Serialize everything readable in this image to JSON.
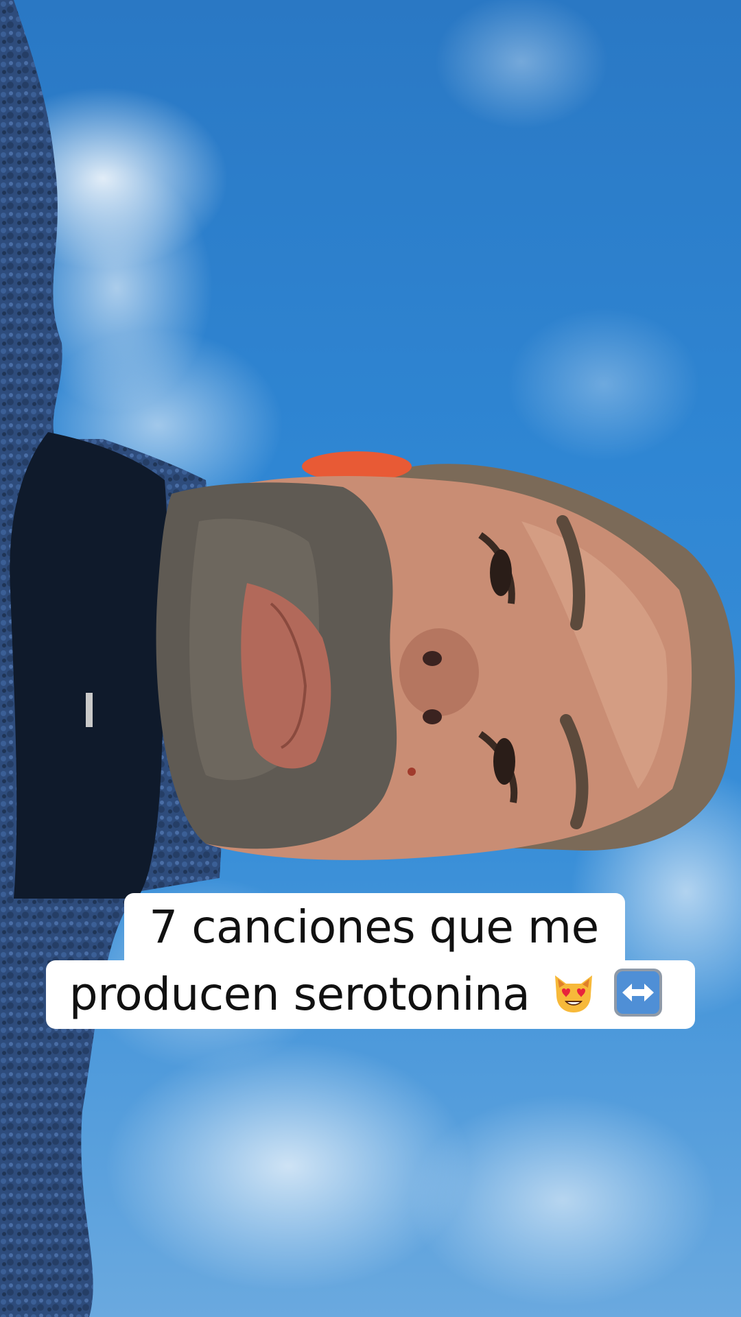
{
  "caption": {
    "line1": "7 canciones que me",
    "line2": "producen serotonina"
  },
  "emojis": {
    "cat": "smiling-cat-heart-eyes-emoji",
    "arrow": "left-right-arrow-emoji"
  },
  "colors": {
    "sky": "#2f86d3",
    "jacket": "#2c4a78",
    "caption_bg": "#ffffff",
    "caption_text": "#111111"
  }
}
